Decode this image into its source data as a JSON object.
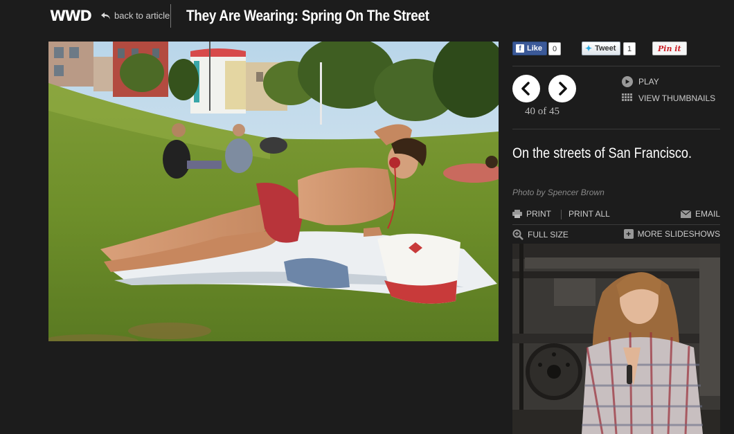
{
  "header": {
    "logo": "WWD",
    "back_label": "back to article",
    "title": "They Are Wearing: Spring On The Street"
  },
  "social": {
    "like_label": "Like",
    "like_count": "0",
    "tweet_label": "Tweet",
    "tweet_count": "1",
    "pin_label": "Pin it"
  },
  "slideshow": {
    "counter": "40 of 45",
    "play_label": "PLAY",
    "thumbnails_label": "VIEW THUMBNAILS",
    "caption": "On the streets of San Francisco.",
    "credit": "Photo by Spencer Brown"
  },
  "tools": {
    "print": "PRINT",
    "print_all": "PRINT ALL",
    "email": "EMAIL",
    "full_size": "FULL SIZE",
    "more_slideshows": "MORE SLIDESHOWS"
  },
  "colors": {
    "background": "#1c1c1c",
    "facebook": "#3b5998",
    "twitter": "#2aa9e0",
    "pinterest": "#cb2027"
  },
  "icons": [
    "back-arrow-icon",
    "facebook-icon",
    "twitter-bird-icon",
    "prev-arrow-icon",
    "next-arrow-icon",
    "play-icon",
    "grid-icon",
    "printer-icon",
    "email-icon",
    "zoom-icon",
    "plus-icon"
  ]
}
